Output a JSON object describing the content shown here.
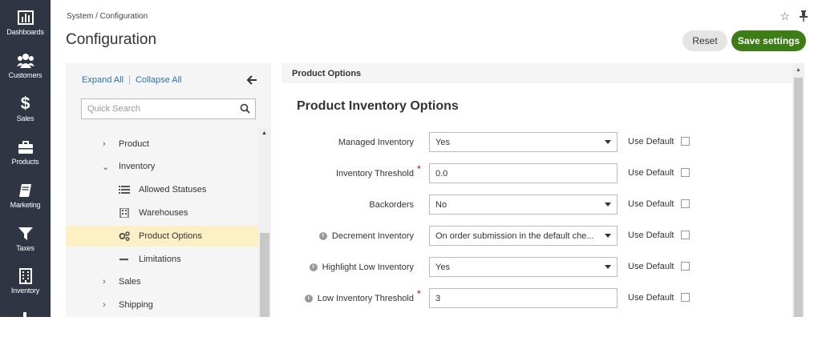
{
  "nav": {
    "items": [
      {
        "label": "Dashboards",
        "icon": "bar-chart-icon"
      },
      {
        "label": "Customers",
        "icon": "users-icon"
      },
      {
        "label": "Sales",
        "icon": "dollar-icon"
      },
      {
        "label": "Products",
        "icon": "briefcase-icon"
      },
      {
        "label": "Marketing",
        "icon": "book-icon"
      },
      {
        "label": "Taxes",
        "icon": "filter-icon"
      },
      {
        "label": "Inventory",
        "icon": "building-icon"
      }
    ]
  },
  "header": {
    "breadcrumb": "System / Configuration",
    "title": "Configuration",
    "reset_label": "Reset",
    "save_label": "Save settings"
  },
  "tree": {
    "expand_all": "Expand All",
    "collapse_all": "Collapse All",
    "search_placeholder": "Quick Search",
    "items": [
      {
        "label": "Product",
        "type": "collapsed"
      },
      {
        "label": "Inventory",
        "type": "expanded"
      },
      {
        "label": "Allowed Statuses",
        "type": "leaf",
        "icon": "list-icon"
      },
      {
        "label": "Warehouses",
        "type": "leaf",
        "icon": "warehouse-icon"
      },
      {
        "label": "Product Options",
        "type": "leaf",
        "icon": "cogs-icon",
        "active": true
      },
      {
        "label": "Limitations",
        "type": "leaf",
        "icon": "minus-icon"
      },
      {
        "label": "Sales",
        "type": "collapsed"
      },
      {
        "label": "Shipping",
        "type": "collapsed"
      }
    ]
  },
  "content": {
    "header": "Product Options",
    "section_title": "Product Inventory Options",
    "use_default_label": "Use Default",
    "fields": [
      {
        "label": "Managed Inventory",
        "type": "select",
        "value": "Yes",
        "required": false,
        "info": false
      },
      {
        "label": "Inventory Threshold",
        "type": "text",
        "value": "0.0",
        "required": true,
        "info": false
      },
      {
        "label": "Backorders",
        "type": "select",
        "value": "No",
        "required": false,
        "info": false
      },
      {
        "label": "Decrement Inventory",
        "type": "select",
        "value": "On order submission in the default che...",
        "required": false,
        "info": true
      },
      {
        "label": "Highlight Low Inventory",
        "type": "select",
        "value": "Yes",
        "required": false,
        "info": true
      },
      {
        "label": "Low Inventory Threshold",
        "type": "text",
        "value": "3",
        "required": true,
        "info": true
      }
    ]
  }
}
